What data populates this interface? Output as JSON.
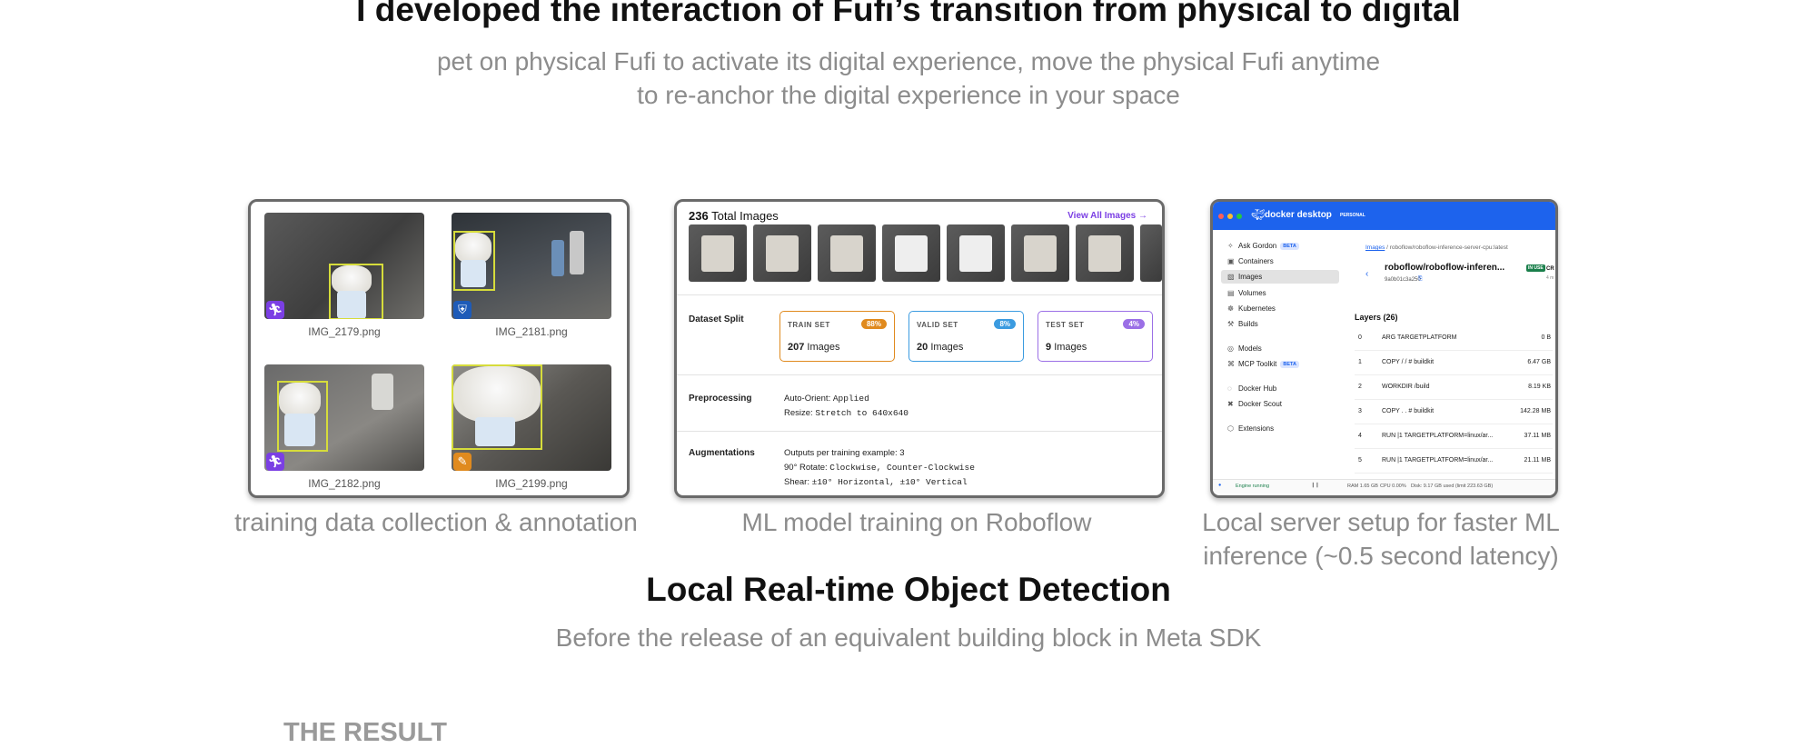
{
  "header": {
    "title": "I developed the interaction of Fufi’s transition from physical to digital",
    "subtitle_line1": "pet on physical Fufi to activate its digital experience, move the physical Fufi anytime",
    "subtitle_line2": "to re-anchor the digital experience in your space"
  },
  "cards": {
    "annotation": {
      "caption": "training data collection & annotation",
      "images": [
        {
          "filename": "IMG_2179.png",
          "badge_icon": "person-icon",
          "badge_color": "#7b3fe4"
        },
        {
          "filename": "IMG_2181.png",
          "badge_icon": "shield-icon",
          "badge_color": "#1e5bb8"
        },
        {
          "filename": "IMG_2182.png",
          "badge_icon": "person-icon",
          "badge_color": "#7b3fe4"
        },
        {
          "filename": "IMG_2199.png",
          "badge_icon": "pencil-icon",
          "badge_color": "#e08a1e"
        }
      ]
    },
    "roboflow": {
      "caption": "ML model training on Roboflow",
      "total_count": "236",
      "total_label": "Total Images",
      "view_all": "View All Images",
      "dataset_split_label": "Dataset Split",
      "sets": [
        {
          "name": "TRAIN SET",
          "pct": "88%",
          "count": "207",
          "unit": "Images",
          "color": "#e08a1e"
        },
        {
          "name": "VALID SET",
          "pct": "8%",
          "count": "20",
          "unit": "Images",
          "color": "#3b9be0"
        },
        {
          "name": "TEST SET",
          "pct": "4%",
          "count": "9",
          "unit": "Images",
          "color": "#9b6fe6"
        }
      ],
      "preprocessing_label": "Preprocessing",
      "preprocessing": [
        {
          "key": "Auto-Orient:",
          "value": "Applied"
        },
        {
          "key": "Resize:",
          "value": "Stretch to 640x640"
        }
      ],
      "augmentations_label": "Augmentations",
      "augmentations": [
        {
          "key": "Outputs per training example:",
          "value": "3",
          "mono": false
        },
        {
          "key": "90° Rotate:",
          "value": "Clockwise, Counter-Clockwise",
          "mono": true
        },
        {
          "key": "Shear:",
          "value": "±10° Horizontal, ±10° Vertical",
          "mono": true
        }
      ]
    },
    "docker": {
      "caption_line1": "Local server setup for faster ML",
      "caption_line2": "inference (~0.5 second latency)",
      "app_name": "docker desktop",
      "plan_badge": "PERSONAL",
      "sidebar": [
        {
          "label": "Ask Gordon",
          "icon": "sparkle-icon",
          "beta": "BETA"
        },
        {
          "label": "Containers",
          "icon": "containers-icon"
        },
        {
          "label": "Images",
          "icon": "images-icon",
          "active": true
        },
        {
          "label": "Volumes",
          "icon": "volumes-icon"
        },
        {
          "label": "Kubernetes",
          "icon": "kubernetes-icon"
        },
        {
          "label": "Builds",
          "icon": "builds-icon"
        },
        {
          "label": "Models",
          "icon": "models-icon"
        },
        {
          "label": "MCP Toolkit",
          "icon": "mcp-icon",
          "beta": "BETA"
        },
        {
          "label": "Docker Hub",
          "icon": "hub-icon"
        },
        {
          "label": "Docker Scout",
          "icon": "scout-icon"
        },
        {
          "label": "Extensions",
          "icon": "extensions-icon"
        }
      ],
      "breadcrumb_link": "Images",
      "breadcrumb_path": "roboflow/roboflow-inference-server-cpu:latest",
      "image_title": "roboflow/roboflow-inferen...",
      "in_use": "IN USE",
      "image_hash": "9a0b01c3a250",
      "cut_right_top": "CR",
      "cut_right_bottom": "4 m",
      "layers_title": "Layers (26)",
      "layers": [
        {
          "n": "0",
          "cmd": "ARG TARGETPLATFORM",
          "size": "0 B"
        },
        {
          "n": "1",
          "cmd": "COPY / / # buildkit",
          "size": "6.47 GB"
        },
        {
          "n": "2",
          "cmd": "WORKDIR /build",
          "size": "8.19 KB"
        },
        {
          "n": "3",
          "cmd": "COPY . . # buildkit",
          "size": "142.28 MB"
        },
        {
          "n": "4",
          "cmd": "RUN |1 TARGETPLATFORM=linux/ar...",
          "size": "37.11 MB"
        },
        {
          "n": "5",
          "cmd": "RUN |1 TARGETPLATFORM=linux/ar...",
          "size": "21.11 MB"
        }
      ],
      "status": {
        "engine": "Engine running",
        "ram": "RAM 1.65 GB",
        "cpu": "CPU 0.00%",
        "disk": "Disk: 9.17 GB used (limit 223.63 GB)"
      },
      "brand_color": "#1d63ed"
    }
  },
  "section": {
    "title": "Local Real-time Object Detection",
    "subtitle": "Before the release of an equivalent building block in Meta SDK"
  },
  "result_label": "THE RESULT"
}
